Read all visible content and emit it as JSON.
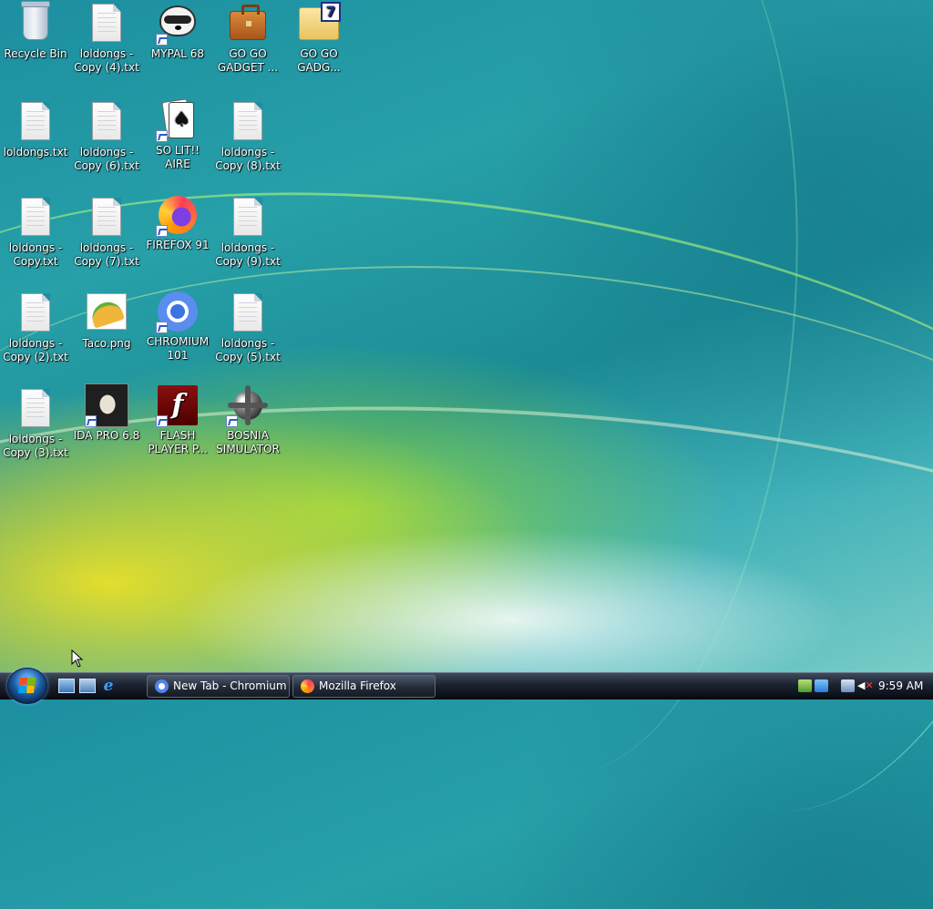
{
  "desktop": {
    "icons": [
      {
        "label": "Recycle Bin"
      },
      {
        "label": "loldongs - Copy (4).txt"
      },
      {
        "label": "MYPAL 68"
      },
      {
        "label": "GO GO GADGET ..."
      },
      {
        "label": "GO GO GADG..."
      },
      {
        "label": "loldongs.txt"
      },
      {
        "label": "loldongs - Copy (6).txt"
      },
      {
        "label": "SO LIT!! AIRE"
      },
      {
        "label": "loldongs - Copy (8).txt"
      },
      {
        "label": "loldongs - Copy.txt"
      },
      {
        "label": "loldongs - Copy (7).txt"
      },
      {
        "label": "FIREFOX 91"
      },
      {
        "label": "loldongs - Copy (9).txt"
      },
      {
        "label": "loldongs - Copy (2).txt"
      },
      {
        "label": "Taco.png"
      },
      {
        "label": "CHROMIUM 101"
      },
      {
        "label": "loldongs - Copy (5).txt"
      },
      {
        "label": "loldongs - Copy (3).txt"
      },
      {
        "label": "IDA PRO 6.8"
      },
      {
        "label": "FLASH PLAYER P..."
      },
      {
        "label": "BOSNIA SIMULATOR"
      }
    ]
  },
  "taskbar": {
    "buttons": [
      {
        "label": "New Tab - Chromium",
        "icon": "chromium-icon"
      },
      {
        "label": "Mozilla Firefox",
        "icon": "firefox-icon"
      }
    ],
    "clock": "9:59 AM",
    "volume_muted_glyph": "✕",
    "ie_glyph": "e",
    "flash_glyph": "f",
    "card_glyph": "♠",
    "folder_badge": "7",
    "colors": {
      "taskbar": "#1b2230",
      "accent": "#1f5fa8"
    }
  }
}
